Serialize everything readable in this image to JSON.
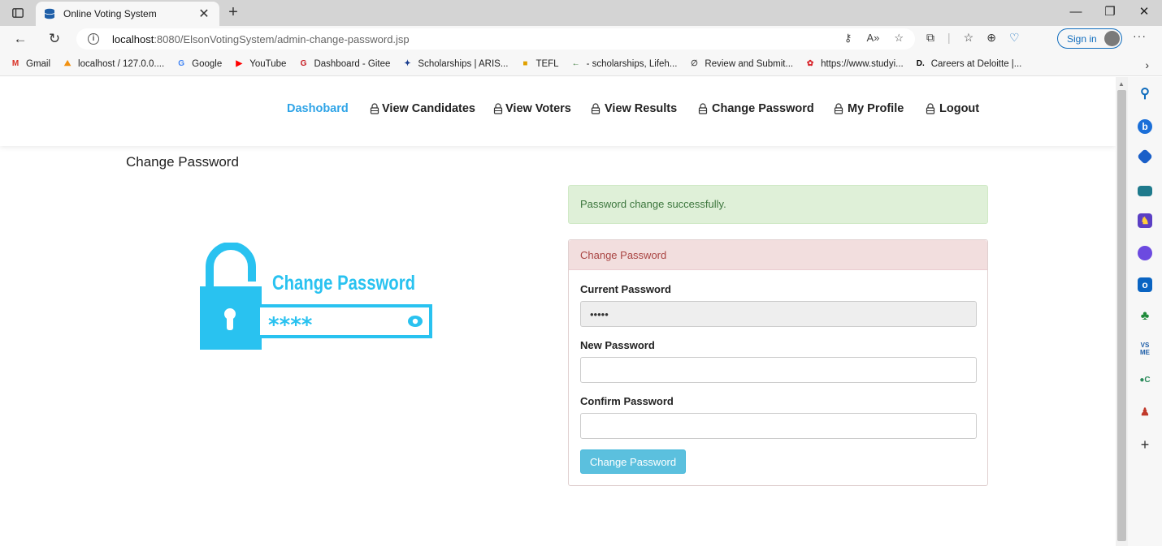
{
  "browser": {
    "tab_title": "Online Voting System",
    "url_host": "localhost",
    "url_path": ":8080/ElsonVotingSystem/admin-change-password.jsp",
    "signin_label": "Sign in"
  },
  "bookmarks": [
    {
      "label": "Gmail",
      "icon": "gmail-icon",
      "color": "#d93025",
      "glyph": "M"
    },
    {
      "label": "localhost / 127.0.0....",
      "icon": "phpmyadmin-icon",
      "color": "#f29111",
      "glyph": "⛰"
    },
    {
      "label": "Google",
      "icon": "google-icon",
      "color": "#4285f4",
      "glyph": "G"
    },
    {
      "label": "YouTube",
      "icon": "youtube-icon",
      "color": "#ff0000",
      "glyph": "▶"
    },
    {
      "label": "Dashboard - Gitee",
      "icon": "gitee-icon",
      "color": "#c71d23",
      "glyph": "G"
    },
    {
      "label": "Scholarships | ARIS...",
      "icon": "aris-icon",
      "color": "#1a3d8f",
      "glyph": "✦"
    },
    {
      "label": "TEFL",
      "icon": "tefl-icon",
      "color": "#e0a000",
      "glyph": "■"
    },
    {
      "label": "- scholarships, Lifeh...",
      "icon": "lifehack-icon",
      "color": "#3b7a3b",
      "glyph": "←"
    },
    {
      "label": "Review and Submit...",
      "icon": "review-icon",
      "color": "#555555",
      "glyph": "∅"
    },
    {
      "label": "https://www.studyi...",
      "icon": "studyin-icon",
      "color": "#d8232a",
      "glyph": "✿"
    },
    {
      "label": "Careers at Deloitte |...",
      "icon": "deloitte-icon",
      "color": "#000000",
      "glyph": "D."
    }
  ],
  "nav": {
    "items": [
      {
        "label": "Dashobard",
        "active": true
      },
      {
        "label": "View Candidates",
        "active": false
      },
      {
        "label": "View Voters",
        "active": false
      },
      {
        "label": "View Results",
        "active": false
      },
      {
        "label": "Change Password",
        "active": false
      },
      {
        "label": "My Profile",
        "active": false
      },
      {
        "label": "Logout",
        "active": false
      }
    ]
  },
  "page": {
    "heading": "Change Password",
    "illustration_text": "Change Password",
    "illustration_mask": "****"
  },
  "alert": {
    "message": "Password change successfully."
  },
  "form": {
    "title": "Change Password",
    "current_label": "Current Password",
    "current_value": "•••••",
    "new_label": "New Password",
    "new_value": "",
    "confirm_label": "Confirm Password",
    "confirm_value": "",
    "submit_label": "Change Password"
  },
  "colors": {
    "accent": "#2fa4e7",
    "illustration": "#29c2f0",
    "success_bg": "#dff0d8",
    "danger_bg": "#f2dede",
    "button": "#5bc0de"
  }
}
